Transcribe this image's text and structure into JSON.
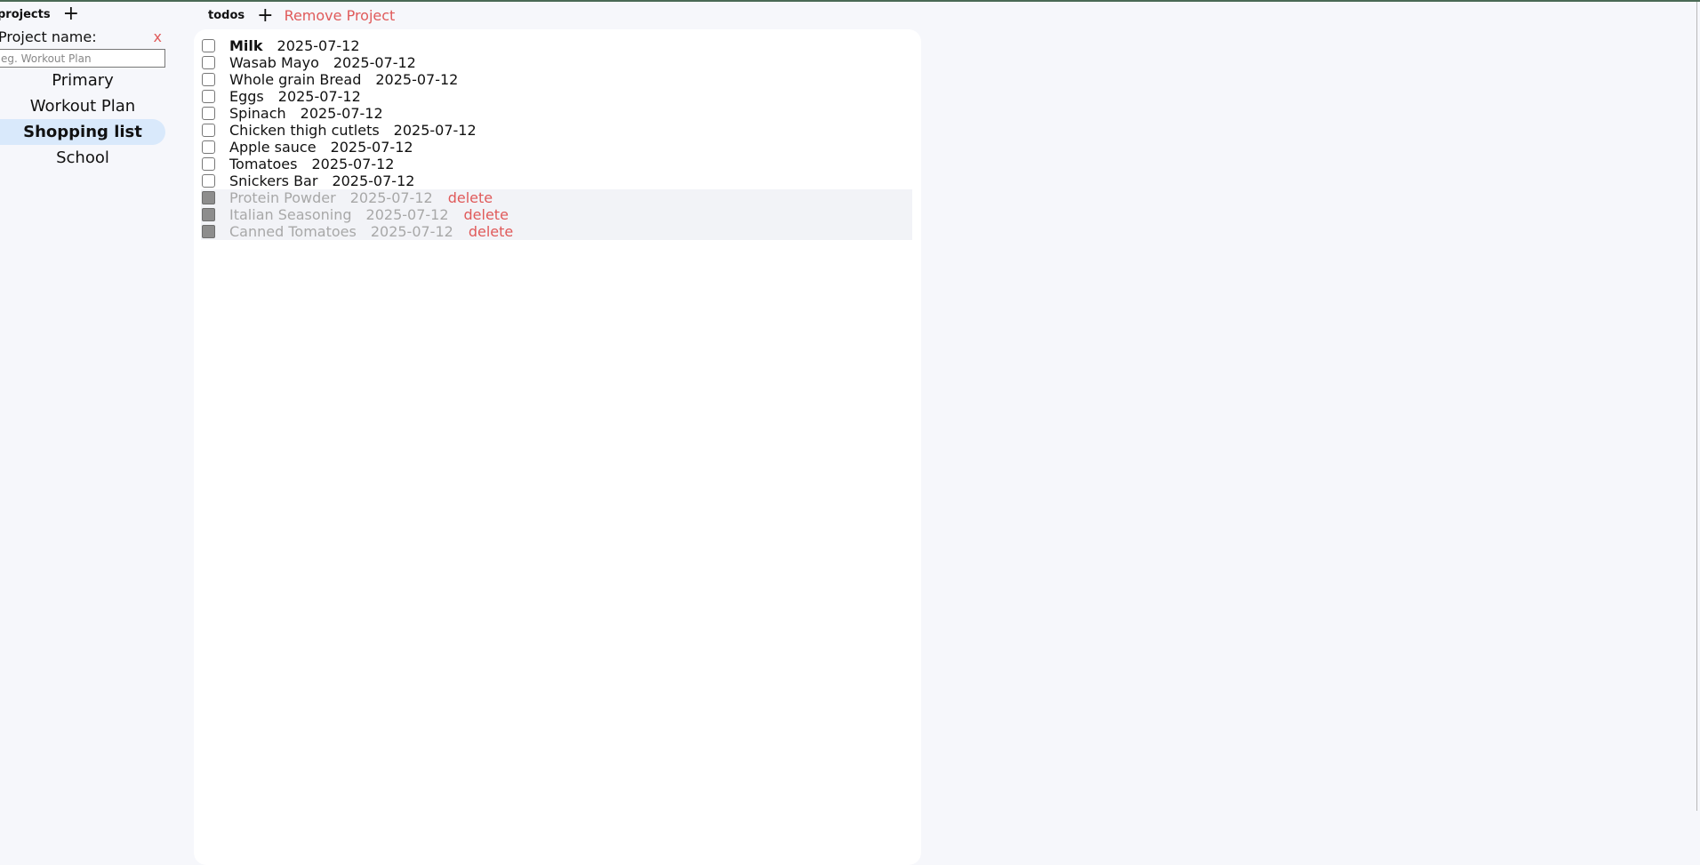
{
  "sidebar": {
    "title": "projects",
    "add_icon": "plus-icon",
    "form_label": "Project name:",
    "close_label": "x",
    "input_placeholder": "eg. Workout Plan",
    "projects": [
      {
        "label": "Primary",
        "active": false
      },
      {
        "label": "Workout Plan",
        "active": false
      },
      {
        "label": "Shopping list",
        "active": true
      },
      {
        "label": "School",
        "active": false
      }
    ]
  },
  "main": {
    "title": "todos",
    "add_icon": "plus-icon",
    "remove_label": "Remove Project",
    "todos": [
      {
        "title": "Milk",
        "date": "2025-07-12",
        "done": false
      },
      {
        "title": "Wasab Mayo",
        "date": "2025-07-12",
        "done": false
      },
      {
        "title": "Whole grain Bread",
        "date": "2025-07-12",
        "done": false
      },
      {
        "title": "Eggs",
        "date": "2025-07-12",
        "done": false
      },
      {
        "title": "Spinach",
        "date": "2025-07-12",
        "done": false
      },
      {
        "title": "Chicken thigh cutlets",
        "date": "2025-07-12",
        "done": false
      },
      {
        "title": "Apple sauce",
        "date": "2025-07-12",
        "done": false
      },
      {
        "title": "Tomatoes",
        "date": "2025-07-12",
        "done": false
      },
      {
        "title": "Snickers Bar",
        "date": "2025-07-12",
        "done": false
      },
      {
        "title": "Protein Powder",
        "date": "2025-07-12",
        "done": true,
        "delete_label": "delete"
      },
      {
        "title": "Italian Seasoning",
        "date": "2025-07-12",
        "done": true,
        "delete_label": "delete"
      },
      {
        "title": "Canned Tomatoes",
        "date": "2025-07-12",
        "done": true,
        "delete_label": "delete"
      }
    ]
  },
  "colors": {
    "accent_red": "#e05a5a",
    "active_project_bg": "#d9e9fb",
    "page_bg": "#f6f7fb"
  }
}
